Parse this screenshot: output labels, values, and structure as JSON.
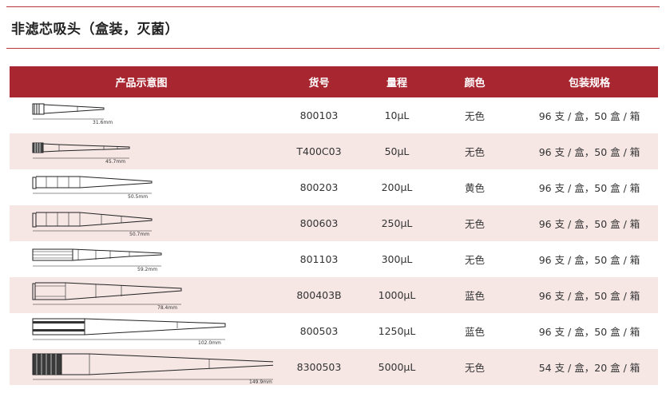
{
  "title": "非滤芯吸头（盒装，灭菌）",
  "table": {
    "headers": [
      "产品示意图",
      "货号",
      "量程",
      "颜色",
      "包装规格"
    ],
    "rows": [
      {
        "diagram_label": "31.6mm",
        "sku": "800103",
        "range": "10µL",
        "color": "无色",
        "package": "96 支 / 盒，50 盒 / 箱"
      },
      {
        "diagram_label": "45.7mm",
        "sku": "T400C03",
        "range": "50µL",
        "color": "无色",
        "package": "96 支 / 盒，50 盒 / 箱"
      },
      {
        "diagram_label": "50.5mm",
        "sku": "800203",
        "range": "200µL",
        "color": "黄色",
        "package": "96 支 / 盒，50 盒 / 箱"
      },
      {
        "diagram_label": "50.7mm",
        "sku": "800603",
        "range": "250µL",
        "color": "无色",
        "package": "96 支 / 盒，50 盒 / 箱"
      },
      {
        "diagram_label": "59.2mm",
        "sku": "801103",
        "range": "300µL",
        "color": "无色",
        "package": "96 支 / 盒，50 盒 / 箱"
      },
      {
        "diagram_label": "78.4mm",
        "sku": "800403B",
        "range": "1000µL",
        "color": "蓝色",
        "package": "96 支 / 盒，50 盒 / 箱"
      },
      {
        "diagram_label": "102.0mm",
        "sku": "800503",
        "range": "1250µL",
        "color": "蓝色",
        "package": "96 支 / 盒，50 盒 / 箱"
      },
      {
        "diagram_label": "149.9mm",
        "sku": "8300503",
        "range": "5000µL",
        "color": "无色",
        "package": "54 支 / 盒，20 盒 / 箱"
      }
    ]
  },
  "colors": {
    "accent": "#a82630",
    "alt_row": "#f6e7e5"
  }
}
